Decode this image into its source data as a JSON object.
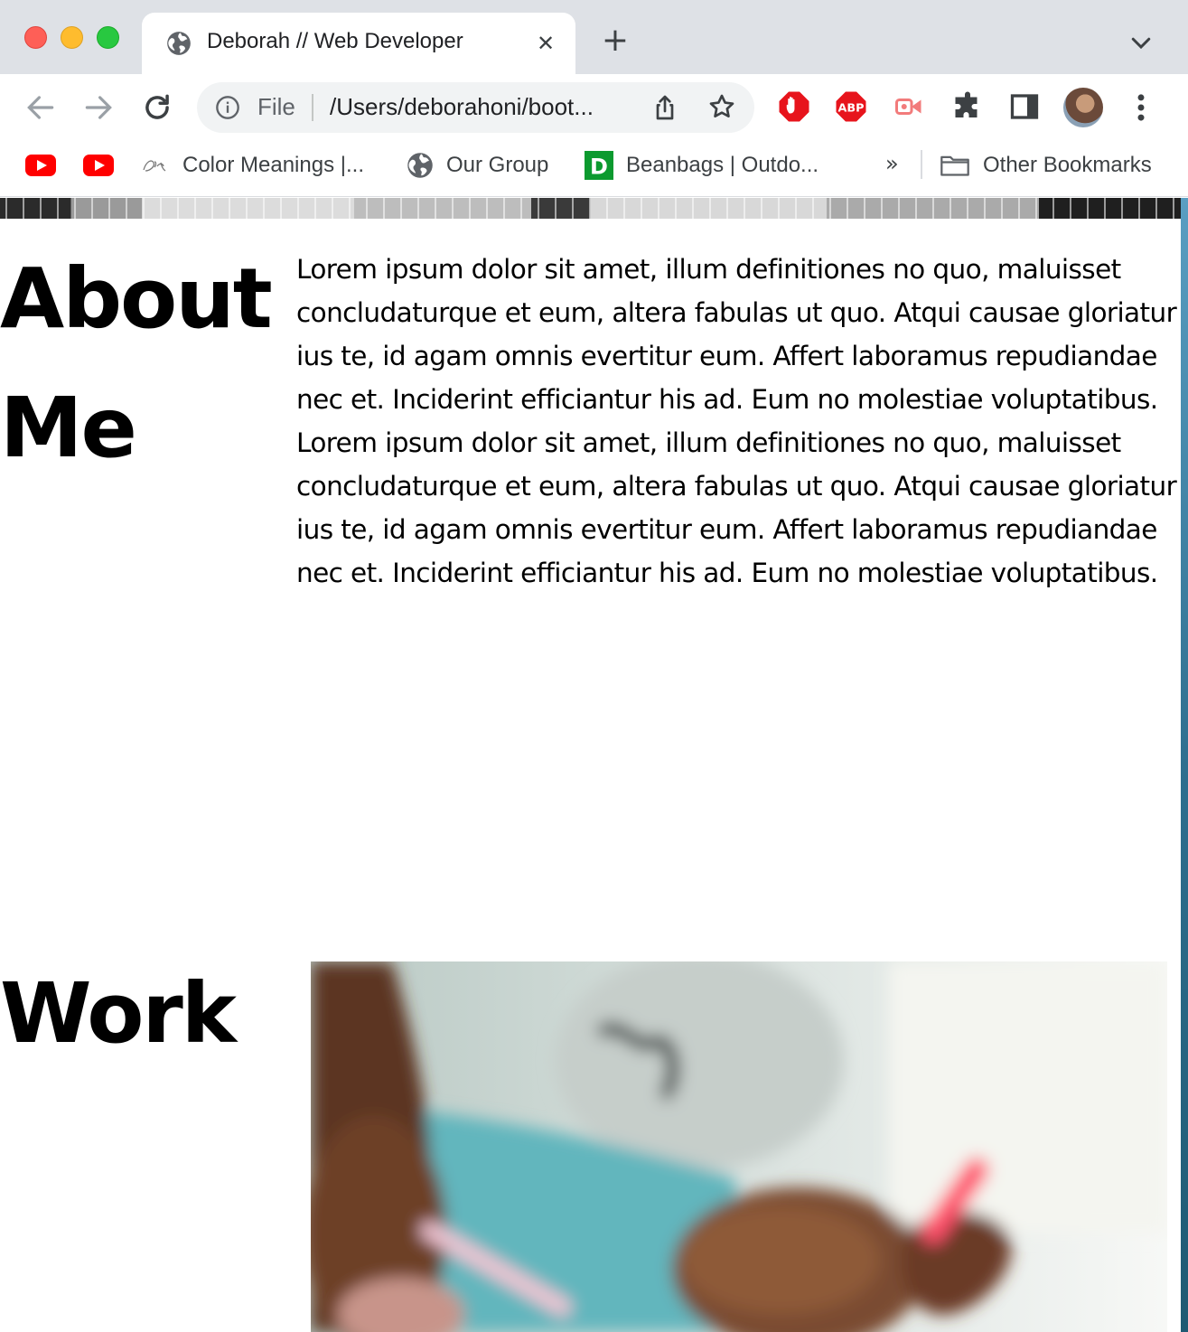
{
  "browser": {
    "tab": {
      "title": "Deborah // Web Developer"
    },
    "address": {
      "scheme": "File",
      "url": "/Users/deborahoni/boot..."
    },
    "bookmarks": [
      {
        "label": "Color Meanings |..."
      },
      {
        "label": "Our Group"
      },
      {
        "label": "Beanbags | Outdo..."
      },
      {
        "label": "Other Bookmarks"
      }
    ],
    "overflow": "»",
    "colors": {
      "tabstrip": "#dee1e6",
      "omnibox": "#f1f3f4",
      "youtube": "#ff0000",
      "adblock_red": "#e7141c",
      "dunelm_green": "#0c9a2f"
    }
  },
  "page": {
    "about": {
      "heading": "About Me",
      "body": "Lorem ipsum dolor sit amet, illum definitiones no quo, maluisset concludaturque et eum, altera fabulas ut quo. Atqui causae gloriatur ius te, id agam omnis evertitur eum. Affert laboramus repudiandae nec et. Inciderint efficiantur his ad. Eum no molestiae voluptatibus. Lorem ipsum dolor sit amet, illum definitiones no quo, maluisset concludaturque et eum, altera fabulas ut quo. Atqui causae gloriatur ius te, id agam omnis evertitur eum. Affert laboramus repudiandae nec et. Inciderint efficiantur his ad. Eum no molestiae voluptatibus."
    },
    "work": {
      "heading": "Work"
    }
  }
}
